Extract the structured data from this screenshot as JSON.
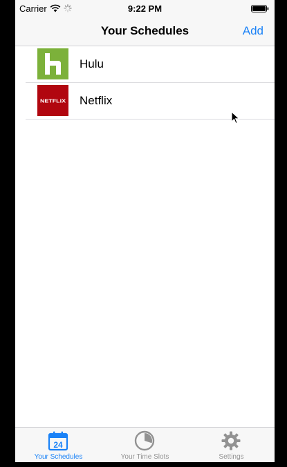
{
  "status_bar": {
    "carrier": "Carrier",
    "time": "9:22 PM"
  },
  "nav": {
    "title": "Your Schedules",
    "add_label": "Add"
  },
  "schedules": [
    {
      "label": "Hulu",
      "icon": "hulu-logo",
      "logo_text": "h",
      "color": "#7cb13a"
    },
    {
      "label": "Netflix",
      "icon": "netflix-logo",
      "logo_text": "NETFLIX",
      "color": "#b1060f"
    }
  ],
  "tabs": [
    {
      "label": "Your Schedules",
      "icon": "calendar-icon",
      "badge": "24",
      "active": true
    },
    {
      "label": "Your Time Slots",
      "icon": "pie-chart-icon",
      "active": false
    },
    {
      "label": "Settings",
      "icon": "gear-icon",
      "active": false
    }
  ],
  "colors": {
    "accent": "#1a82f7",
    "inactive": "#929292"
  }
}
